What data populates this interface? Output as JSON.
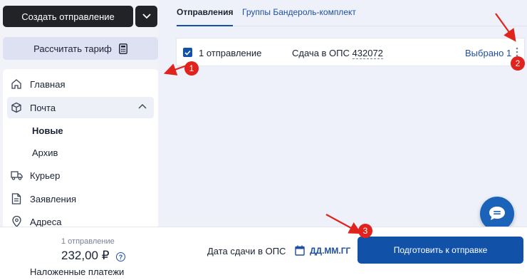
{
  "sidebar": {
    "create_label": "Создать отправление",
    "calc_label": "Рассчитать тариф",
    "nav": [
      {
        "label": "Главная",
        "icon": "home-icon"
      },
      {
        "label": "Почта",
        "icon": "package-icon"
      },
      {
        "label": "Курьер",
        "icon": "truck-icon"
      },
      {
        "label": "Заявления",
        "icon": "document-icon"
      },
      {
        "label": "Адреса",
        "icon": "location-pin-icon"
      }
    ],
    "sub": [
      "Новые",
      "Архив"
    ]
  },
  "tabs": [
    "Отправления",
    "Группы Бандероль-комплект"
  ],
  "row": {
    "count": "1 отправление",
    "ops_label": "Сдача в ОПС",
    "ops_number": "432072",
    "selected": "Выбрано 1"
  },
  "bottom": {
    "count": "1 отправление",
    "price": "232,00 ₽",
    "help": "?",
    "sub_item": "Наложенные платежи",
    "date_label": "Дата сдачи в ОПС",
    "date_value": "ДД.ММ.ГГ",
    "prepare": "Подготовить к отправке"
  },
  "markers": [
    "1",
    "2",
    "3"
  ],
  "colors": {
    "primary": "#1152a8",
    "dark": "#222326",
    "annotation": "#e0231c",
    "link": "#1f4fa0"
  }
}
